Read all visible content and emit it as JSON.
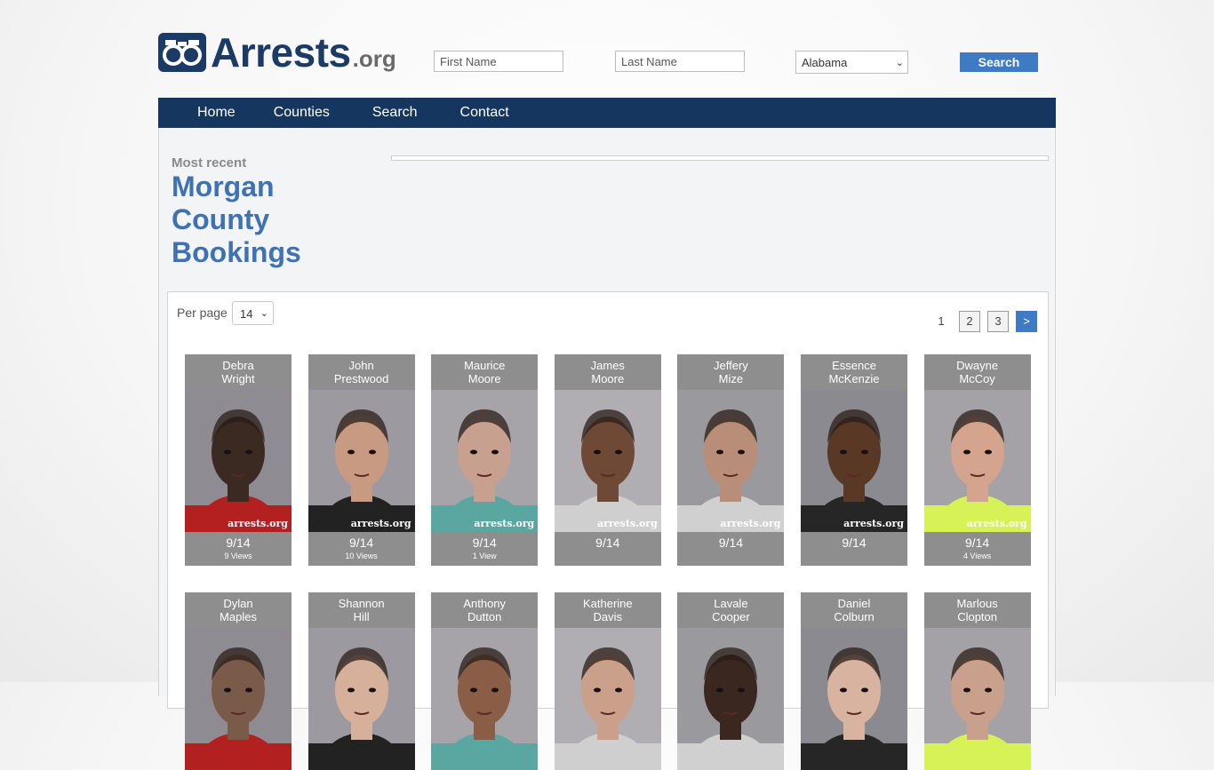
{
  "header": {
    "logo_text": "Arrests",
    "logo_tld": ".org",
    "first_name_placeholder": "First Name",
    "last_name_placeholder": "Last Name",
    "state_selected": "Alabama",
    "search_label": "Search"
  },
  "nav": {
    "items": [
      {
        "label": "Home"
      },
      {
        "label": "Counties"
      },
      {
        "label": "Search"
      },
      {
        "label": "Contact"
      }
    ]
  },
  "page": {
    "kicker": "Most recent",
    "title_line1": "Morgan",
    "title_line2": "County",
    "title_line3": "Bookings"
  },
  "listing": {
    "per_page_label": "Per page",
    "per_page_value": "14",
    "pager": [
      {
        "label": "1",
        "type": "current"
      },
      {
        "label": "2",
        "type": "page"
      },
      {
        "label": "3",
        "type": "page"
      },
      {
        "label": ">",
        "type": "next"
      }
    ],
    "watermark": "arrests.org",
    "cards": [
      {
        "first": "Debra",
        "last": "Wright",
        "date": "9/14",
        "views": "9 Views"
      },
      {
        "first": "John",
        "last": "Prestwood",
        "date": "9/14",
        "views": "10 Views"
      },
      {
        "first": "Maurice",
        "last": "Moore",
        "date": "9/14",
        "views": "1 View"
      },
      {
        "first": "James",
        "last": "Moore",
        "date": "9/14",
        "views": ""
      },
      {
        "first": "Jeffery",
        "last": "Mize",
        "date": "9/14",
        "views": ""
      },
      {
        "first": "Essence",
        "last": "McKenzie",
        "date": "9/14",
        "views": ""
      },
      {
        "first": "Dwayne",
        "last": "McCoy",
        "date": "9/14",
        "views": "4 Views"
      },
      {
        "first": "Dylan",
        "last": "Maples",
        "date": "",
        "views": ""
      },
      {
        "first": "Shannon",
        "last": "Hill",
        "date": "",
        "views": ""
      },
      {
        "first": "Anthony",
        "last": "Dutton",
        "date": "",
        "views": ""
      },
      {
        "first": "Katherine",
        "last": "Davis",
        "date": "",
        "views": ""
      },
      {
        "first": "Lavale",
        "last": "Cooper",
        "date": "",
        "views": ""
      },
      {
        "first": "Daniel",
        "last": "Colburn",
        "date": "",
        "views": ""
      },
      {
        "first": "Marlous",
        "last": "Clopton",
        "date": "",
        "views": ""
      }
    ]
  },
  "colors": {
    "brand_navy": "#14365f",
    "accent_blue": "#3e7bc4",
    "title_blue": "#3e72b4",
    "card_gray": "#8f8e8f"
  }
}
